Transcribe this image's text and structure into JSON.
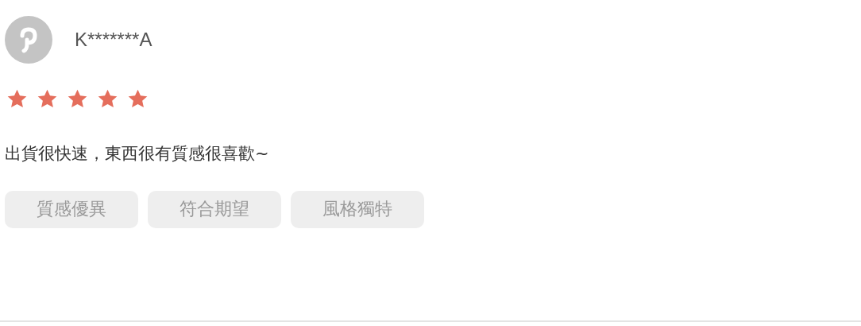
{
  "review": {
    "username": "K*******A",
    "stars": 5,
    "comment": "出貨很快速，東西很有質感很喜歡~",
    "tags": [
      "質感優異",
      "符合期望",
      "風格獨特"
    ]
  }
}
